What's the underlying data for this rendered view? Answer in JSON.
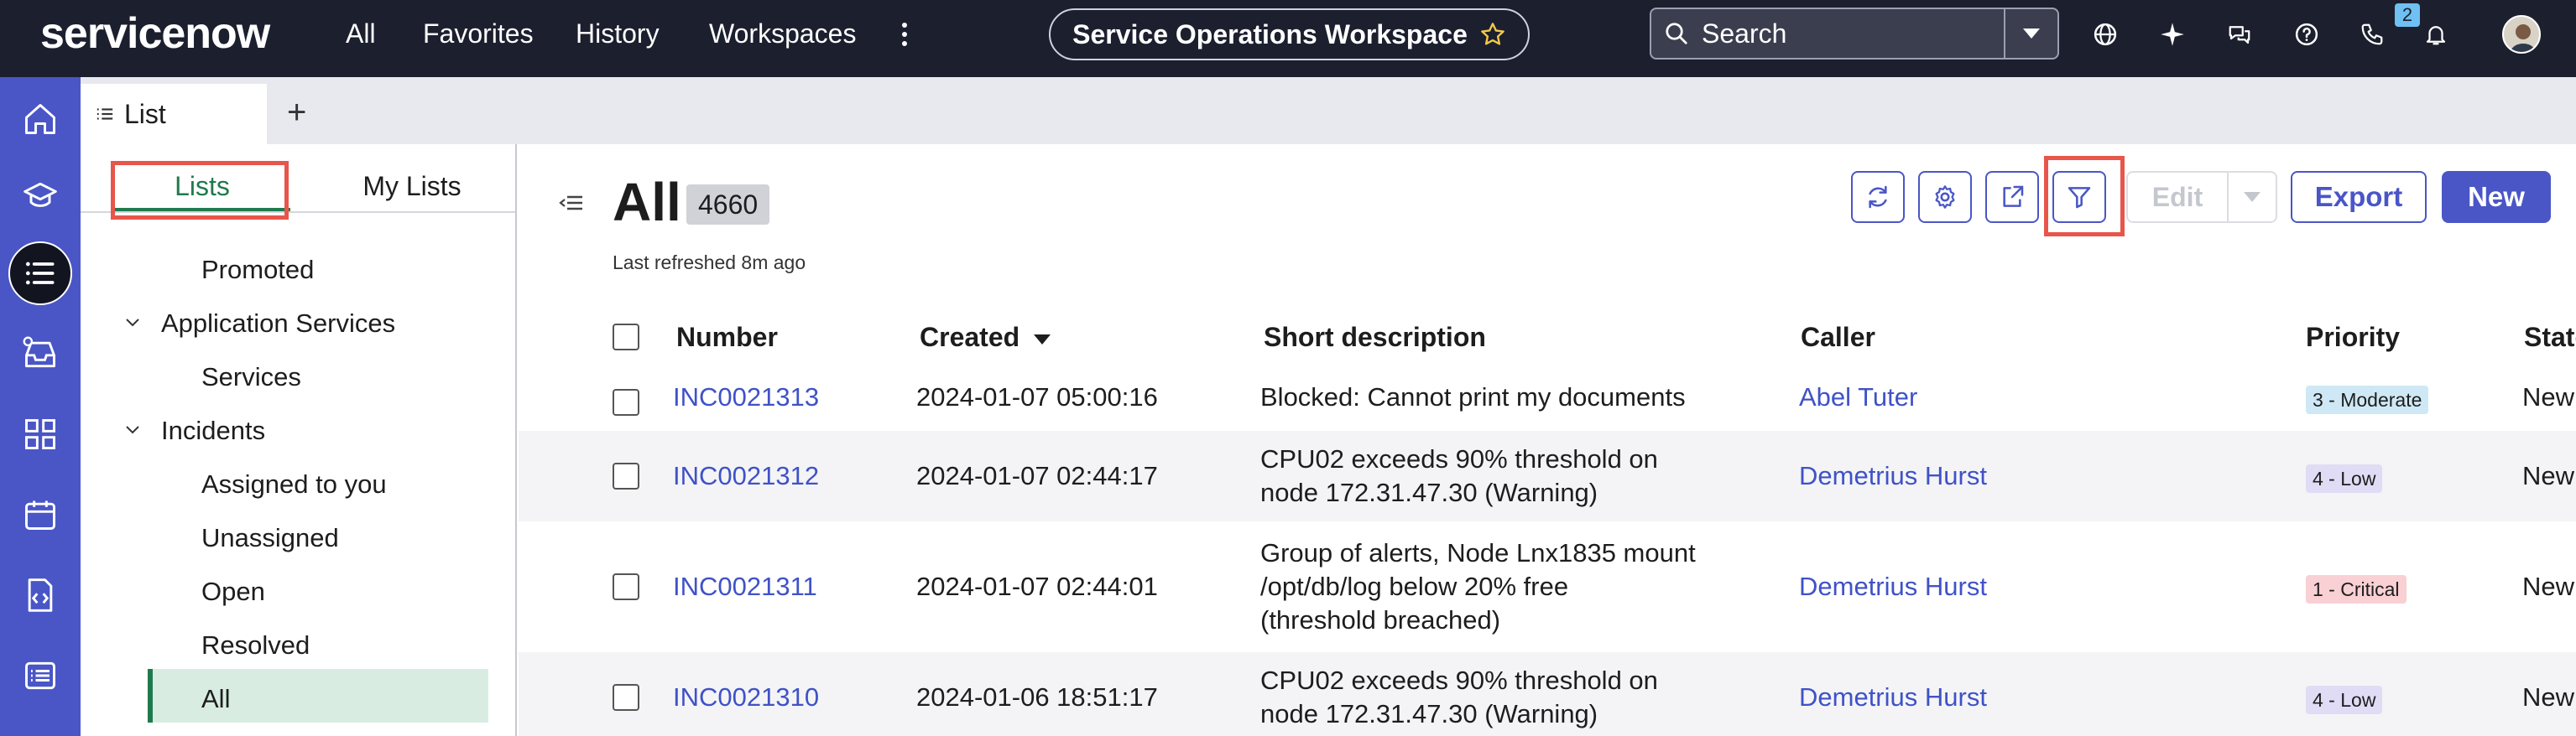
{
  "header": {
    "logo": "servicenow",
    "nav": [
      "All",
      "Favorites",
      "History",
      "Workspaces"
    ],
    "workspace": "Service Operations Workspace",
    "search_label": "Search",
    "notification_count": "2"
  },
  "tabs": {
    "active_label": "List"
  },
  "left_panel": {
    "segments": [
      "Lists",
      "My Lists"
    ],
    "tree": [
      {
        "label": "Promoted",
        "type": "child"
      },
      {
        "label": "Application Services",
        "type": "group"
      },
      {
        "label": "Services",
        "type": "child"
      },
      {
        "label": "Incidents",
        "type": "group"
      },
      {
        "label": "Assigned to you",
        "type": "child"
      },
      {
        "label": "Unassigned",
        "type": "child"
      },
      {
        "label": "Open",
        "type": "child"
      },
      {
        "label": "Resolved",
        "type": "child"
      },
      {
        "label": "All",
        "type": "child",
        "selected": true
      }
    ]
  },
  "main": {
    "title": "All",
    "count": "4660",
    "refreshed": "Last refreshed 8m ago",
    "edit_label": "Edit",
    "export_label": "Export",
    "new_label": "New",
    "columns": [
      "Number",
      "Created",
      "Short description",
      "Caller",
      "Priority",
      "State"
    ],
    "rows": [
      {
        "number": "INC0021313",
        "created": "2024-01-07 05:00:16",
        "desc": [
          "Blocked: Cannot print my documents"
        ],
        "caller": "Abel Tuter",
        "priority": "3 - Moderate",
        "priority_level": "moderate",
        "state": "New"
      },
      {
        "number": "INC0021312",
        "created": "2024-01-07 02:44:17",
        "desc": [
          "CPU02 exceeds 90% threshold on",
          "node 172.31.47.30 (Warning)"
        ],
        "caller": "Demetrius Hurst",
        "priority": "4 - Low",
        "priority_level": "low",
        "state": "New"
      },
      {
        "number": "INC0021311",
        "created": "2024-01-07 02:44:01",
        "desc": [
          "Group of alerts, Node Lnx1835 mount",
          "/opt/db/log below 20% free",
          "(threshold breached)"
        ],
        "caller": "Demetrius Hurst",
        "priority": "1 - Critical",
        "priority_level": "critical",
        "state": "New"
      },
      {
        "number": "INC0021310",
        "created": "2024-01-06 18:51:17",
        "desc": [
          "CPU02 exceeds 90% threshold on",
          "node 172.31.47.30 (Warning)"
        ],
        "caller": "Demetrius Hurst",
        "priority": "4 - Low",
        "priority_level": "low",
        "state": "New"
      }
    ]
  },
  "colors": {
    "nav_bg": "#1c1f2e",
    "rail_bg": "#4a56c6",
    "accent": "#4a56c6",
    "green": "#1f7a4d",
    "highlight": "#e8554a"
  }
}
